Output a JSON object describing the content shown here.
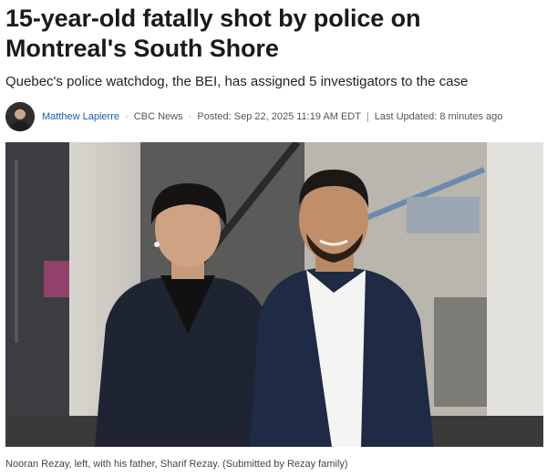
{
  "article": {
    "headline": "15-year-old fatally shot by police on Montreal's South Shore",
    "subheadline": "Quebec's police watchdog, the BEI, has assigned 5 investigators to the case",
    "byline": {
      "author": "Matthew Lapierre",
      "outlet": "CBC News",
      "posted": "Posted: Sep 22, 2025 11:19 AM EDT",
      "updated": "Last Updated: 8 minutes ago",
      "dot_separator": "·",
      "bar_separator": "|"
    },
    "caption": "Nooran Rezay, left, with his father, Sharif Rezay. (Submitted by Rezay family)"
  },
  "icons": {
    "avatar": "author-photo"
  },
  "colors": {
    "author_link": "#1a5bb5",
    "headline": "#1a1a1a"
  }
}
